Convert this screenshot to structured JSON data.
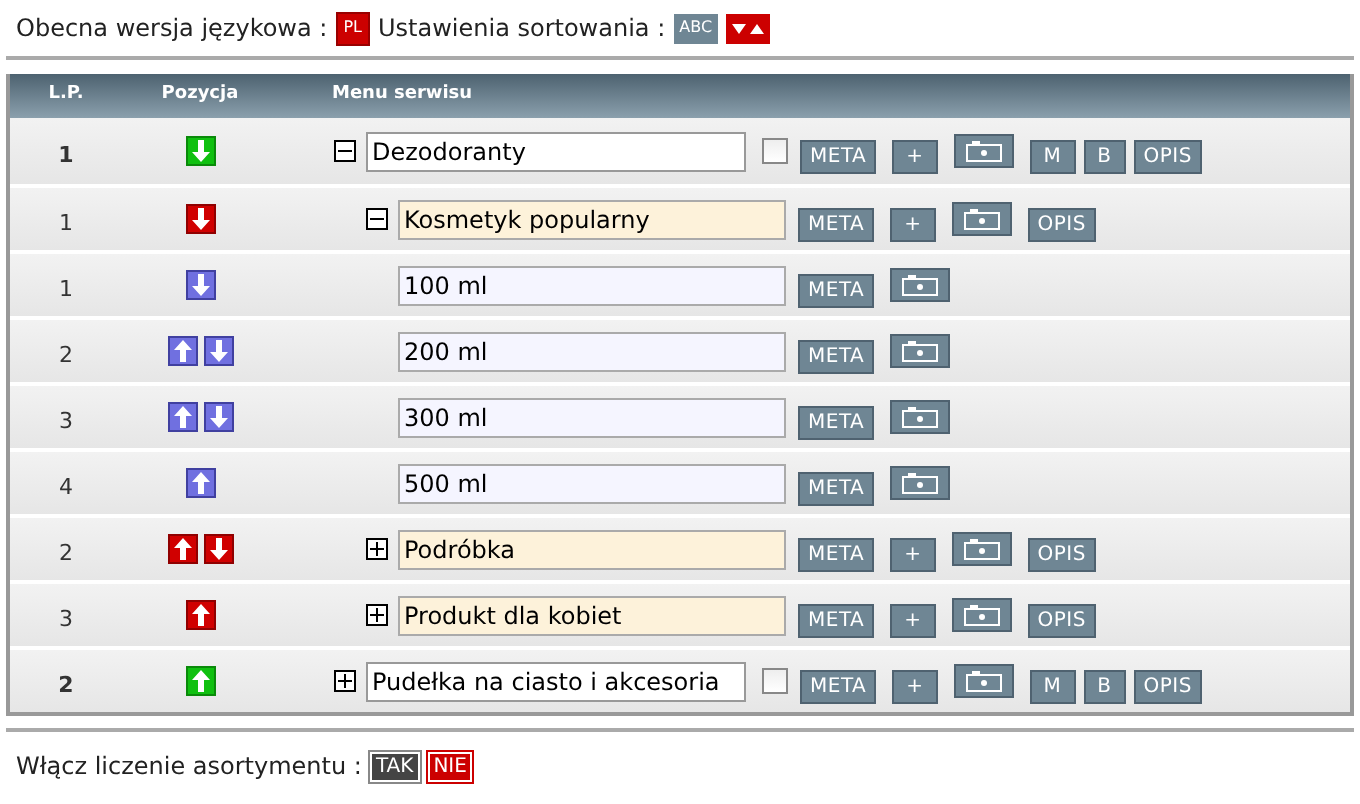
{
  "language": {
    "label": "Obecna wersja językowa :",
    "flag": "PL"
  },
  "sorting": {
    "label": "Ustawienia sortowania :",
    "options": [
      {
        "kind": "text",
        "label": "ABC",
        "selected": false
      },
      {
        "kind": "arrows",
        "selected": true
      }
    ]
  },
  "table": {
    "columns": [
      "L.P.",
      "Pozycja",
      "Menu serwisu"
    ],
    "rows": [
      {
        "kind": "top",
        "lp": "1",
        "up": false,
        "down": true,
        "expanded": true,
        "name": "Dezodoranty",
        "checked": false,
        "buttons": [
          {
            "kind": "text",
            "label": "META"
          },
          {
            "kind": "text",
            "label": "+"
          },
          {
            "kind": "camera"
          },
          {
            "kind": "text",
            "label": "M"
          },
          {
            "kind": "text",
            "label": "B"
          },
          {
            "kind": "text",
            "label": "OPIS"
          }
        ]
      },
      {
        "kind": "sub",
        "lp": "1",
        "up": false,
        "down": true,
        "expanded": true,
        "name": "Kosmetyk popularny",
        "buttons": [
          {
            "kind": "text",
            "label": "META"
          },
          {
            "kind": "text",
            "label": "+"
          },
          {
            "kind": "camera"
          },
          {
            "kind": "text",
            "label": "OPIS"
          }
        ]
      },
      {
        "kind": "leaf",
        "lp": "1",
        "up": false,
        "down": true,
        "name": "100 ml",
        "buttons": [
          {
            "kind": "text",
            "label": "META"
          },
          {
            "kind": "camera"
          }
        ]
      },
      {
        "kind": "leaf",
        "lp": "2",
        "up": true,
        "down": true,
        "name": "200 ml",
        "buttons": [
          {
            "kind": "text",
            "label": "META"
          },
          {
            "kind": "camera"
          }
        ]
      },
      {
        "kind": "leaf",
        "lp": "3",
        "up": true,
        "down": true,
        "name": "300 ml",
        "buttons": [
          {
            "kind": "text",
            "label": "META"
          },
          {
            "kind": "camera"
          }
        ]
      },
      {
        "kind": "leaf",
        "lp": "4",
        "up": true,
        "down": false,
        "name": "500 ml",
        "buttons": [
          {
            "kind": "text",
            "label": "META"
          },
          {
            "kind": "camera"
          }
        ]
      },
      {
        "kind": "sub",
        "lp": "2",
        "up": true,
        "down": true,
        "expanded": false,
        "name": "Podróbka",
        "buttons": [
          {
            "kind": "text",
            "label": "META"
          },
          {
            "kind": "text",
            "label": "+"
          },
          {
            "kind": "camera"
          },
          {
            "kind": "text",
            "label": "OPIS"
          }
        ]
      },
      {
        "kind": "sub",
        "lp": "3",
        "up": true,
        "down": false,
        "expanded": false,
        "name": "Produkt dla kobiet",
        "buttons": [
          {
            "kind": "text",
            "label": "META"
          },
          {
            "kind": "text",
            "label": "+"
          },
          {
            "kind": "camera"
          },
          {
            "kind": "text",
            "label": "OPIS"
          }
        ]
      },
      {
        "kind": "top",
        "lp": "2",
        "up": true,
        "down": false,
        "expanded": false,
        "name": "Pudełka na ciasto i akcesoria",
        "checked": false,
        "buttons": [
          {
            "kind": "text",
            "label": "META"
          },
          {
            "kind": "text",
            "label": "+"
          },
          {
            "kind": "camera"
          },
          {
            "kind": "text",
            "label": "M"
          },
          {
            "kind": "text",
            "label": "B"
          },
          {
            "kind": "text",
            "label": "OPIS"
          }
        ]
      }
    ]
  },
  "counting": {
    "label": "Włącz liczenie asortymentu :",
    "options": [
      {
        "label": "TAK",
        "selected": false
      },
      {
        "label": "NIE",
        "selected": true
      }
    ]
  }
}
